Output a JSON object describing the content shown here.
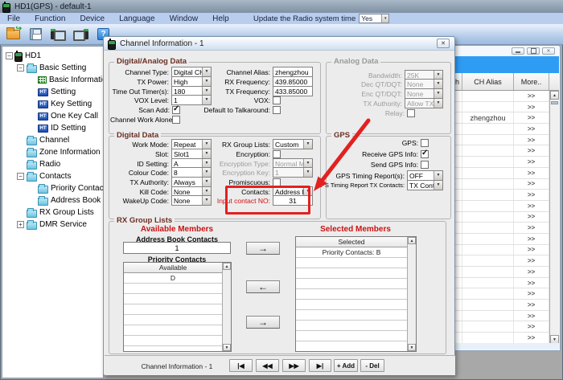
{
  "colors": {
    "annotation_red": "#e32020",
    "section_header_red": "#cc1111",
    "group_title_maroon": "#6b2f23",
    "channel_window_blue": "#2f9cf4"
  },
  "window": {
    "title": "HD1(GPS) - default-1"
  },
  "menu": {
    "items": [
      "File",
      "Function",
      "Device",
      "Language",
      "Window",
      "Help"
    ],
    "update_label": "Update the Radio system time",
    "update_value": "Yes"
  },
  "toolbar": {
    "icons": [
      "open-file",
      "save",
      "read-from-radio",
      "write-to-radio",
      "help"
    ]
  },
  "tree": {
    "ht_icon_text": "HT",
    "nodes": [
      {
        "label": "HD1",
        "level": 0,
        "icon": "radio",
        "expander": "minus"
      },
      {
        "label": "Basic Setting",
        "level": 1,
        "icon": "folder-open",
        "expander": "minus"
      },
      {
        "label": "Basic Information",
        "level": 2,
        "icon": "grid",
        "expander": "none"
      },
      {
        "label": "Setting",
        "level": 2,
        "icon": "ht",
        "expander": "none"
      },
      {
        "label": "Key Setting",
        "level": 2,
        "icon": "ht",
        "expander": "none"
      },
      {
        "label": "One Key Call",
        "level": 2,
        "icon": "ht",
        "expander": "none"
      },
      {
        "label": "ID Setting",
        "level": 2,
        "icon": "ht",
        "expander": "none"
      },
      {
        "label": "Channel",
        "level": 1,
        "icon": "folder",
        "expander": "none"
      },
      {
        "label": "Zone Information",
        "level": 1,
        "icon": "folder",
        "expander": "none"
      },
      {
        "label": "Radio",
        "level": 1,
        "icon": "folder",
        "expander": "none"
      },
      {
        "label": "Contacts",
        "level": 1,
        "icon": "folder-open",
        "expander": "minus"
      },
      {
        "label": "Priority Contacts",
        "level": 2,
        "icon": "folder",
        "expander": "none"
      },
      {
        "label": "Address Book Co",
        "level": 2,
        "icon": "folder",
        "expander": "none"
      },
      {
        "label": "RX Group Lists",
        "level": 1,
        "icon": "folder",
        "expander": "none"
      },
      {
        "label": "DMR Service",
        "level": 1,
        "icon": "folder",
        "expander": "plus"
      }
    ]
  },
  "channel_window": {
    "controls": [
      "minimize",
      "maximize",
      "close"
    ],
    "columns": [
      "th",
      "CH Alias",
      "More.."
    ],
    "more_cell": ">>",
    "rows": [
      "",
      "",
      "zhengzhou",
      "",
      "",
      "",
      "",
      "",
      "",
      "",
      "",
      "",
      "",
      "",
      "",
      "",
      "",
      "",
      "",
      "",
      "",
      "",
      ""
    ]
  },
  "dialog": {
    "title": "Channel Information - 1",
    "digital_analog": {
      "title": "Digital/Analog Data",
      "channel_type": {
        "label": "Channel Type:",
        "value": "Digital CH"
      },
      "tx_power": {
        "label": "TX Power:",
        "value": "High"
      },
      "time_out_timer": {
        "label": "Time Out Timer(s):",
        "value": "180"
      },
      "vox_level": {
        "label": "VOX Level:",
        "value": "1"
      },
      "scan_add": {
        "label": "Scan Add:",
        "checked": true
      },
      "channel_work_alone": {
        "label": "Channel Work Alone:",
        "checked": false
      },
      "channel_alias": {
        "label": "Channel Alias:",
        "value": "zhengzhou"
      },
      "rx_frequency": {
        "label": "RX Frequency:",
        "value": "439.85000"
      },
      "tx_frequency": {
        "label": "TX Frequency:",
        "value": "433.85000"
      },
      "vox": {
        "label": "VOX:",
        "checked": false
      },
      "default_to_talkaround": {
        "label": "Default to Talkaround:",
        "checked": false
      }
    },
    "analog": {
      "title": "Analog Data",
      "bandwidth": {
        "label": "Bandwidth:",
        "value": "25K"
      },
      "dec_qtdqt": {
        "label": "Dec QT/DQT:",
        "value": "None"
      },
      "enc_qtdqt": {
        "label": "Enc QT/DQT:",
        "value": "None"
      },
      "tx_authority": {
        "label": "TX Authority:",
        "value": "Allow TX"
      },
      "relay": {
        "label": "Relay:",
        "checked": false
      }
    },
    "digital": {
      "title": "Digital Data",
      "work_mode": {
        "label": "Work Mode:",
        "value": "Repeat"
      },
      "slot": {
        "label": "Slot:",
        "value": "Slot1"
      },
      "id_setting": {
        "label": "ID Setting:",
        "value": "A"
      },
      "colour_code": {
        "label": "Colour Code:",
        "value": "8"
      },
      "tx_authority": {
        "label": "TX Authority:",
        "value": "Always"
      },
      "kill_code": {
        "label": "Kill Code:",
        "value": "None"
      },
      "wakeup_code": {
        "label": "WakeUp Code:",
        "value": "None"
      },
      "rx_group_lists": {
        "label": "RX Group Lists:",
        "value": "Custom"
      },
      "encryption": {
        "label": "Encryption:",
        "checked": false
      },
      "encryption_type": {
        "label": "Encryption Type:",
        "value": "Normal Moc"
      },
      "encryption_key": {
        "label": "Encryption Key:",
        "value": "1"
      },
      "promiscuous": {
        "label": "Promiscuous:",
        "checked": false
      },
      "contacts": {
        "label": "Contacts:",
        "value": "Address Bo"
      },
      "input_contact_no": {
        "label": "Input contact NO:",
        "value": "31"
      }
    },
    "gps": {
      "title": "GPS",
      "gps": {
        "label": "GPS:",
        "checked": false
      },
      "receive_gps_info": {
        "label": "Receive GPS Info:",
        "checked": true
      },
      "send_gps_info": {
        "label": "Send GPS Info:",
        "checked": false
      },
      "gps_timing_report": {
        "label": "GPS Timing Report(s):",
        "value": "OFF"
      },
      "gps_timing_tx_contacts": {
        "label": "GPS Timing Report TX Contacts:",
        "value": "TX Contact"
      }
    },
    "rx_group": {
      "title": "RX Group Lists",
      "available_header": "Available Members",
      "selected_header": "Selected Members",
      "address_book_label": "Address Book Contacts",
      "address_book_value": "1",
      "priority_label": "Priority Contacts",
      "available_col": "Available",
      "available_items": [
        "D",
        "",
        "",
        "",
        "",
        "",
        "",
        ""
      ],
      "selected_col": "Selected",
      "selected_items": [
        "Priority Contacts: B",
        "",
        "",
        "",
        "",
        "",
        "",
        "",
        "",
        ""
      ],
      "move_buttons": [
        "→",
        "←",
        "→"
      ]
    },
    "footer": {
      "status": "Channel Information - 1",
      "nav": [
        "|◀",
        "◀◀",
        "▶▶",
        "▶|",
        "+ Add",
        "- Del"
      ]
    }
  }
}
